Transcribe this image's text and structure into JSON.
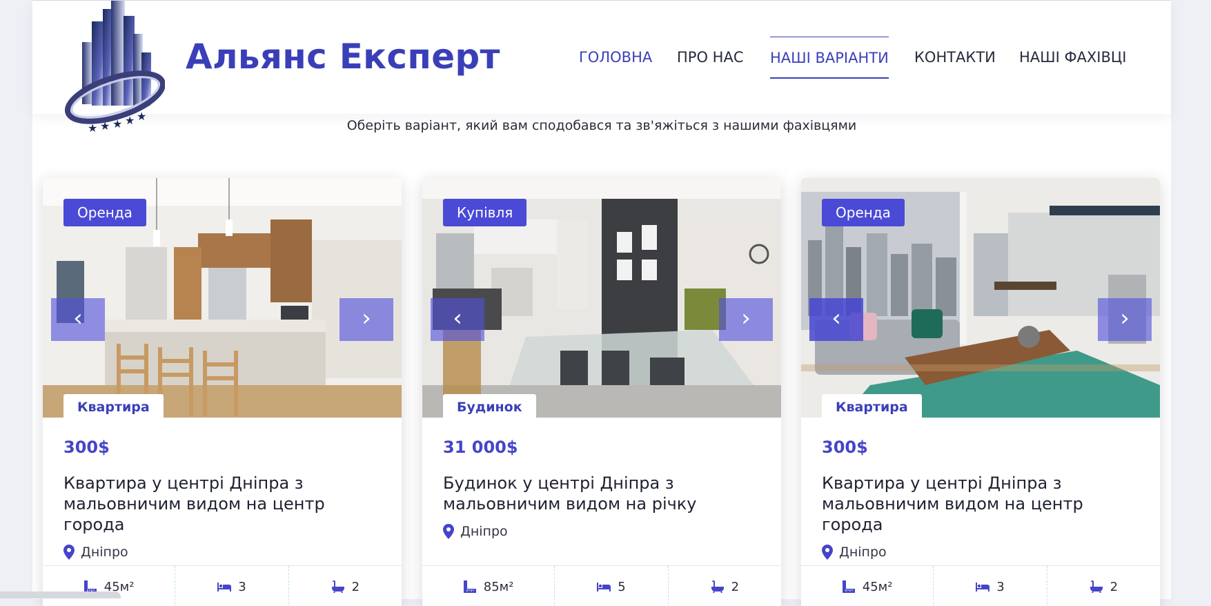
{
  "brand": {
    "name": "Альянс Експерт"
  },
  "nav": {
    "items": [
      {
        "label": "ГОЛОВНА"
      },
      {
        "label": "ПРО НАС"
      },
      {
        "label": "НАШІ ВАРІАНТИ"
      },
      {
        "label": "КОНТАКТИ"
      },
      {
        "label": "НАШІ ФАХІВЦІ"
      }
    ],
    "active": "НАШІ ВАРІАНТИ"
  },
  "subtitle": "Оберіть варіант, який вам сподобався та зв'яжіться з нашими фахівцями",
  "colors": {
    "accent": "#3a3fb8",
    "badge": "#4a4ad6",
    "price": "#4545c8"
  },
  "listings": [
    {
      "deal": "Оренда",
      "type": "Квартира",
      "price": "300$",
      "title": "Квартира у центрі Дніпра з мальовничим видом на центр города",
      "location": "Дніпро",
      "area": "45м²",
      "rooms": "3",
      "baths": "2"
    },
    {
      "deal": "Купівля",
      "type": "Будинок",
      "price": "31 000$",
      "title": "Будинок у центрі Дніпра з мальовничим видом на річку",
      "location": "Дніпро",
      "area": "85м²",
      "rooms": "5",
      "baths": "2"
    },
    {
      "deal": "Оренда",
      "type": "Квартира",
      "price": "300$",
      "title": "Квартира у центрі Дніпра з мальовничим видом на центр города",
      "location": "Дніпро",
      "area": "45м²",
      "rooms": "3",
      "baths": "2"
    }
  ],
  "icons": {
    "prev": "chevron-left-icon",
    "next": "chevron-right-icon",
    "location": "map-pin-icon",
    "area": "ruler-icon",
    "rooms": "bed-icon",
    "baths": "bath-icon"
  }
}
